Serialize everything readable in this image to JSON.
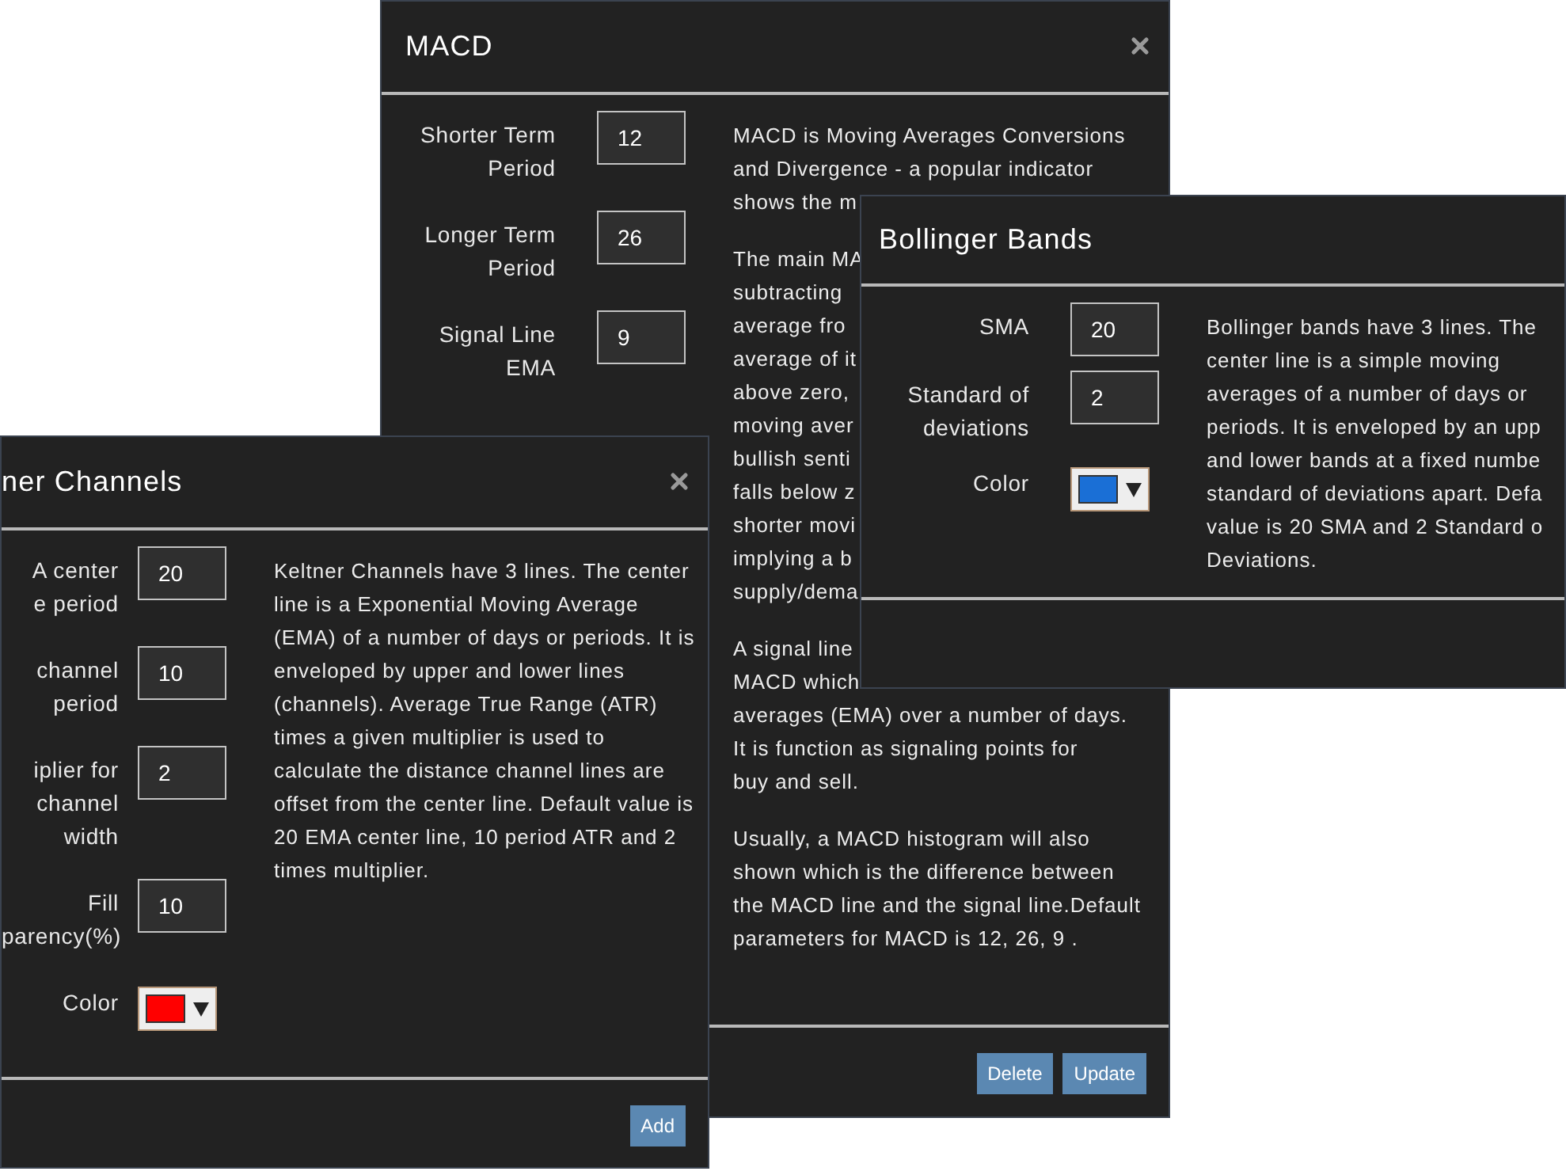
{
  "dialogs": [
    {
      "title": "MACD",
      "close_button": true,
      "fields": [
        {
          "kind": "number",
          "label": "Shorter Term Period",
          "value": "12"
        },
        {
          "kind": "number",
          "label": "Longer Term Period",
          "value": "26"
        },
        {
          "kind": "number",
          "label": "Signal Line EMA",
          "value": "9"
        }
      ],
      "description": [
        {
          "kind": "lines",
          "lines": [
            "MACD is Moving Averages Conversions",
            "and Divergence - a popular indicator",
            "shows the m"
          ]
        },
        {
          "kind": "lines",
          "lines": [
            "The main MA",
            "subtracting",
            "average fro",
            "average of it",
            "above zero,",
            "moving aver",
            "bullish senti",
            "falls below z",
            "shorter movi",
            "implying a b",
            "supply/dema"
          ]
        },
        {
          "kind": "lines",
          "lines": [
            "A signal line",
            "MACD which",
            "averages (EMA) over a number of days.",
            "It is function as signaling points for",
            "buy and sell."
          ]
        },
        {
          "kind": "paragraph",
          "text": "Usually, a MACD histogram will also shown which is the difference between the MACD line and the signal line.Default parameters for MACD is 12, 26, 9 ."
        }
      ],
      "buttons": [
        "Delete",
        "Update"
      ]
    },
    {
      "title": "Bollinger Bands",
      "fields": [
        {
          "kind": "number",
          "label": "SMA",
          "value": "20"
        },
        {
          "kind": "number",
          "label": "Standard of deviations",
          "value": "2"
        },
        {
          "kind": "color",
          "label": "Color",
          "color": "#1a6fd6"
        }
      ],
      "description": [
        {
          "kind": "lines",
          "lines": [
            "Bollinger bands have 3 lines. The",
            "center line is a simple moving",
            "averages of a number of days or",
            "periods. It is enveloped by an upp",
            "and lower bands at a fixed numbe",
            "standard of deviations apart. Defa",
            "value is 20 SMA and 2 Standard o",
            "Deviations."
          ]
        }
      ]
    },
    {
      "title": "ner Channels",
      "close_button": true,
      "fields": [
        {
          "kind": "number",
          "label": "A center\ne period",
          "value": "20"
        },
        {
          "kind": "number",
          "label": "channel\nperiod",
          "value": "10"
        },
        {
          "kind": "number",
          "label": "iplier for\nchannel\nwidth",
          "value": "2"
        },
        {
          "kind": "number",
          "label": "Fill\nparency(%)",
          "value": "10"
        },
        {
          "kind": "color",
          "label": "Color",
          "color": "#ff0000"
        }
      ],
      "description": [
        {
          "kind": "paragraph",
          "text": "Keltner Channels have 3 lines. The center line is a Exponential Moving Average (EMA) of a number of days or periods. It is enveloped by upper and lower lines (channels). Average True Range (ATR) times a given multiplier is used to calculate the distance channel lines are offset from the center line. Default value is 20 EMA center line, 10 period ATR and 2 times multiplier."
        }
      ],
      "buttons": [
        "Add"
      ]
    }
  ]
}
